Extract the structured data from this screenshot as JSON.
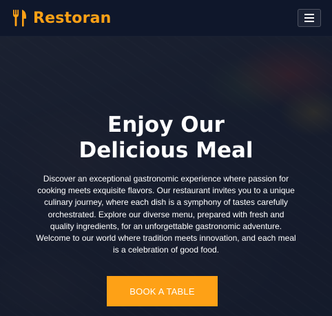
{
  "navbar": {
    "brand_name": "Restoran",
    "brand_icon": "utensils-icon",
    "menu_icon": "hamburger-menu-icon"
  },
  "hero": {
    "title_line1": "Enjoy Our",
    "title_line2": "Delicious Meal",
    "description": "Discover an exceptional gastronomic experience where passion for cooking meets exquisite flavors. Our restaurant invites you to a unique culinary journey, where each dish is a symphony of tastes carefully orchestrated. Explore our diverse menu, prepared with fresh and quality ingredients, for an unforgettable gastronomic adventure. Welcome to our world where tradition meets innovation, and each meal is a celebration of good food.",
    "cta_label": "BOOK A TABLE"
  },
  "colors": {
    "accent": "#fea116",
    "navbar_bg": "#0f172b",
    "text": "#ffffff"
  }
}
